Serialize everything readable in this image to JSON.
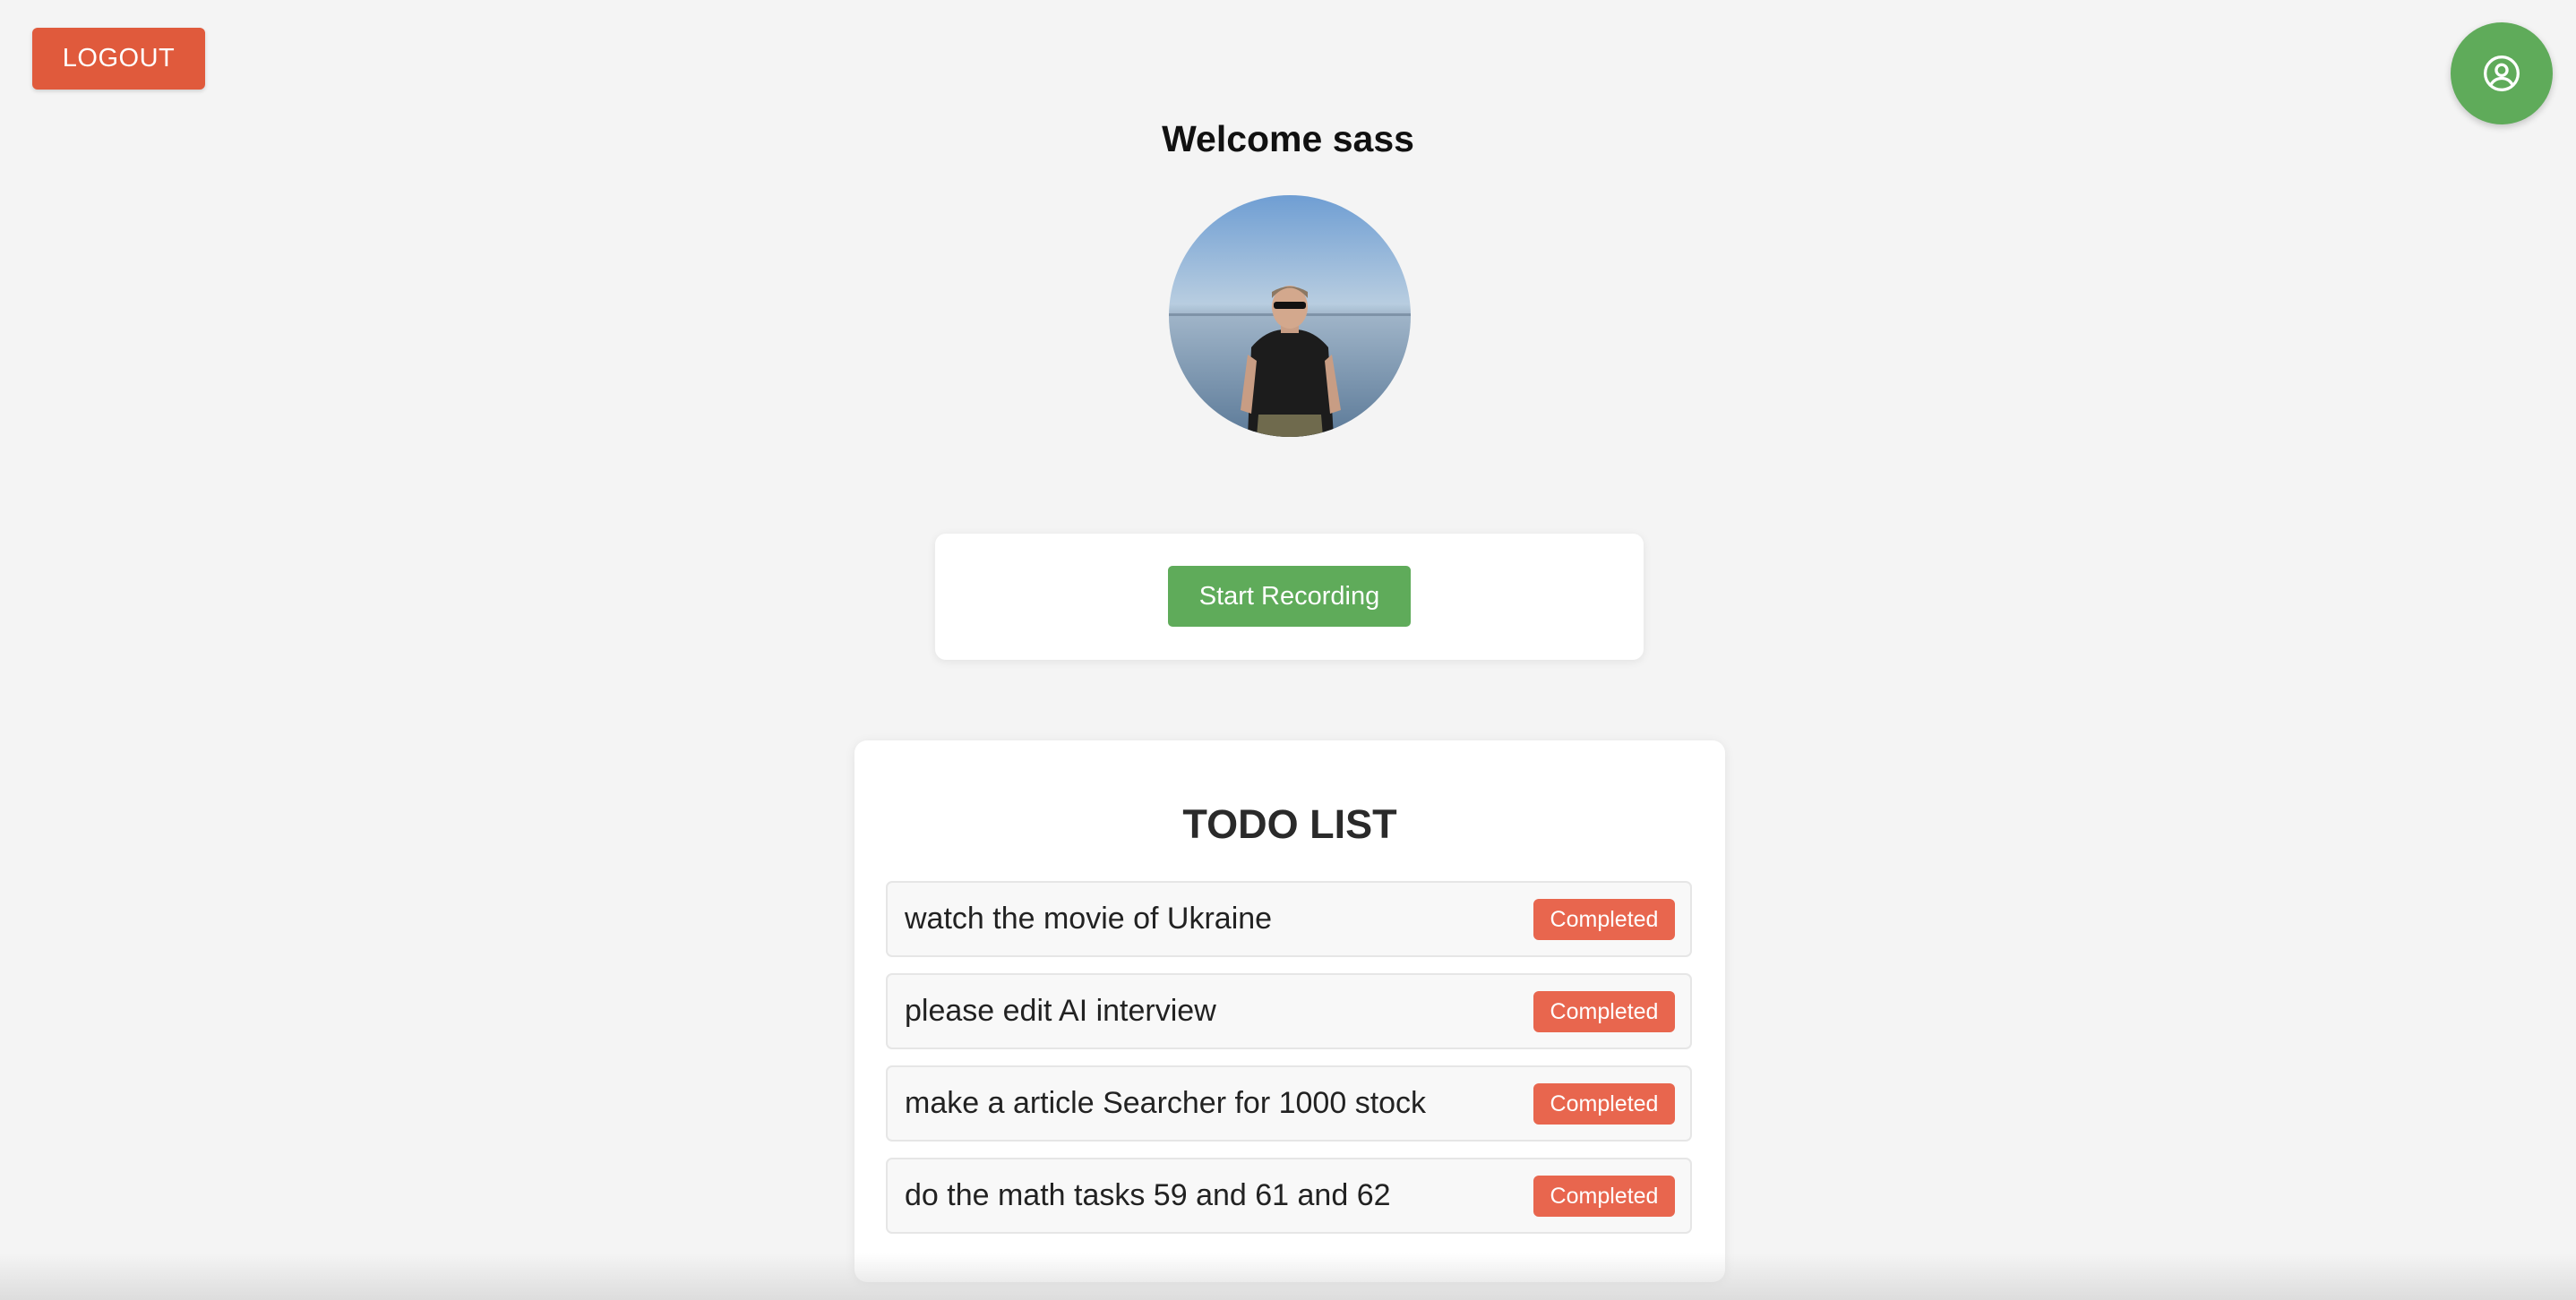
{
  "header": {
    "logout_label": "LOGOUT",
    "profile_icon": "user-circle-icon",
    "welcome_text": "Welcome sass"
  },
  "recorder": {
    "start_label": "Start Recording"
  },
  "todo": {
    "title": "TODO LIST",
    "items": [
      {
        "text": "watch the movie of Ukraine",
        "status": "Completed"
      },
      {
        "text": "please edit AI interview",
        "status": "Completed"
      },
      {
        "text": "make a article Searcher for 1000 stock",
        "status": "Completed"
      },
      {
        "text": "do the math tasks 59 and 61 and 62",
        "status": "Completed"
      }
    ]
  },
  "colors": {
    "background": "#f4f4f4",
    "logout": "#e05a3c",
    "primary_green": "#5fab5a",
    "completed_badge": "#e8664e"
  }
}
